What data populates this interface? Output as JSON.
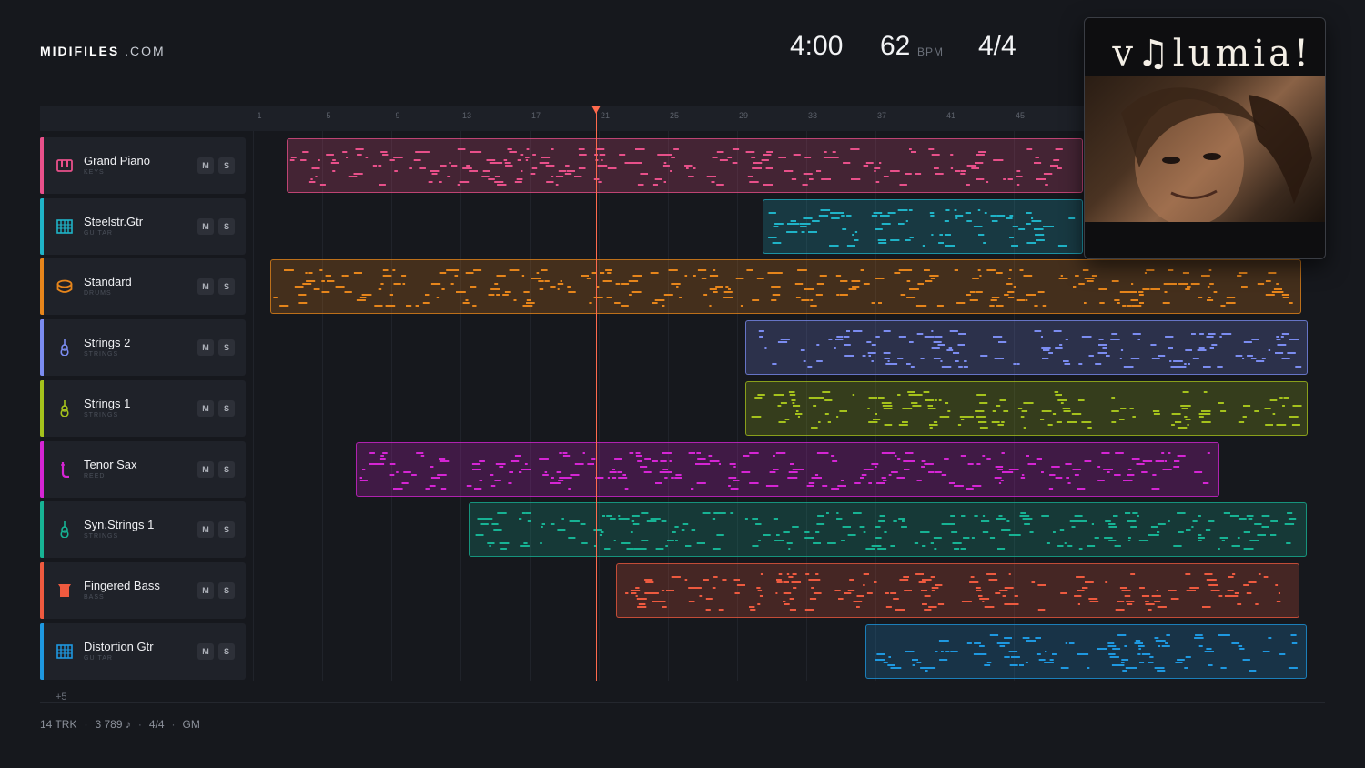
{
  "logo": {
    "bold": "MIDIFILES",
    "rest": " .COM"
  },
  "stats": {
    "duration": "4:00",
    "bpm": "62",
    "bpm_unit": "BPM",
    "time_signature": "4/4"
  },
  "cover": {
    "title": "v♫lumia!"
  },
  "ruler": {
    "bars": [
      "1",
      "5",
      "9",
      "13",
      "17",
      "21",
      "25",
      "29",
      "33",
      "37",
      "41",
      "45"
    ]
  },
  "playhead": {
    "bar": 21
  },
  "tracks": [
    {
      "name": "Grand Piano",
      "category": "KEYS",
      "color": "#e8508a",
      "icon": "piano-icon",
      "mute": "M",
      "solo": "S"
    },
    {
      "name": "Steelstr.Gtr",
      "category": "GUITAR",
      "color": "#1fb3c7",
      "icon": "guitar-fretboard-icon",
      "mute": "M",
      "solo": "S"
    },
    {
      "name": "Standard",
      "category": "DRUMS",
      "color": "#e6851b",
      "icon": "drum-icon",
      "mute": "M",
      "solo": "S"
    },
    {
      "name": "Strings 2",
      "category": "STRINGS",
      "color": "#7b8cf0",
      "icon": "violin-icon",
      "mute": "M",
      "solo": "S"
    },
    {
      "name": "Strings 1",
      "category": "STRINGS",
      "color": "#a5c21c",
      "icon": "violin-icon",
      "mute": "M",
      "solo": "S"
    },
    {
      "name": "Tenor Sax",
      "category": "REED",
      "color": "#d525d4",
      "icon": "saxophone-icon",
      "mute": "M",
      "solo": "S"
    },
    {
      "name": "Syn.Strings 1",
      "category": "STRINGS",
      "color": "#17b394",
      "icon": "violin-icon",
      "mute": "M",
      "solo": "S"
    },
    {
      "name": "Fingered Bass",
      "category": "BASS",
      "color": "#ee5a3f",
      "icon": "bass-icon",
      "mute": "M",
      "solo": "S"
    },
    {
      "name": "Distortion Gtr",
      "category": "GUITAR",
      "color": "#1e98e0",
      "icon": "guitar-fretboard-icon",
      "mute": "M",
      "solo": "S"
    }
  ],
  "more_tracks": "+5",
  "footer": {
    "tracks": "14 TRK",
    "notes": "3 789 ♪",
    "time_signature": "4/4",
    "standard": "GM"
  }
}
